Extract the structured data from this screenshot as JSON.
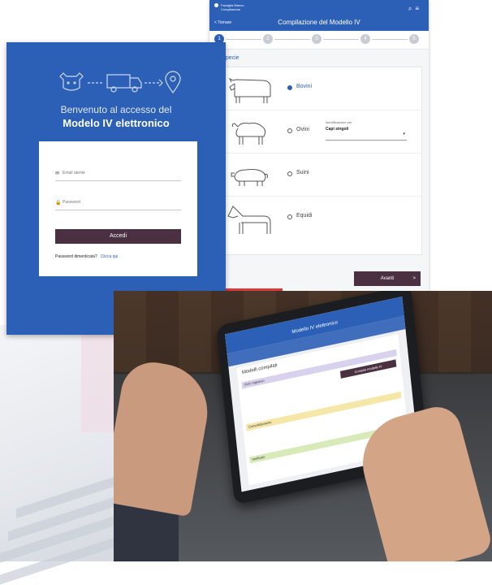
{
  "login": {
    "welcome": "Benvenuto al accesso del",
    "title": "Modelo IV elettronico",
    "email_placeholder": "Email utente",
    "password_placeholder": "Password",
    "submit_label": "Accedi",
    "forgot_label": "Password dimenticata?",
    "forgot_link": "Clicca qui"
  },
  "species_form": {
    "header_title": "Compilazione del Modello IV",
    "back_label": "< Tornare",
    "brand_line1": "Famiglia Bianco",
    "brand_line2": "Compilazione",
    "steps": [
      "1",
      "2",
      "3",
      "4",
      "5"
    ],
    "section_label": "gli la specie",
    "options": [
      {
        "label": "Bovini",
        "selected": true
      },
      {
        "label": "Ovini",
        "selected": false
      },
      {
        "label": "Suini",
        "selected": false
      },
      {
        "label": "Equidi",
        "selected": false
      }
    ],
    "ident_label": "Identificazione per",
    "ident_value": "Capi singoli",
    "next_label": "Avanti",
    "next_arrow": ">"
  },
  "tablet": {
    "header": "Modello IV elettronico",
    "content_title": "Modelli compilati",
    "compile_button": "Compila modello IV",
    "band1": "Ciclo Ingrasso",
    "band2": "Consolidamento",
    "band3": "Verificato"
  },
  "colors": {
    "primary": "#2c5fb6",
    "button": "#4a3040"
  }
}
